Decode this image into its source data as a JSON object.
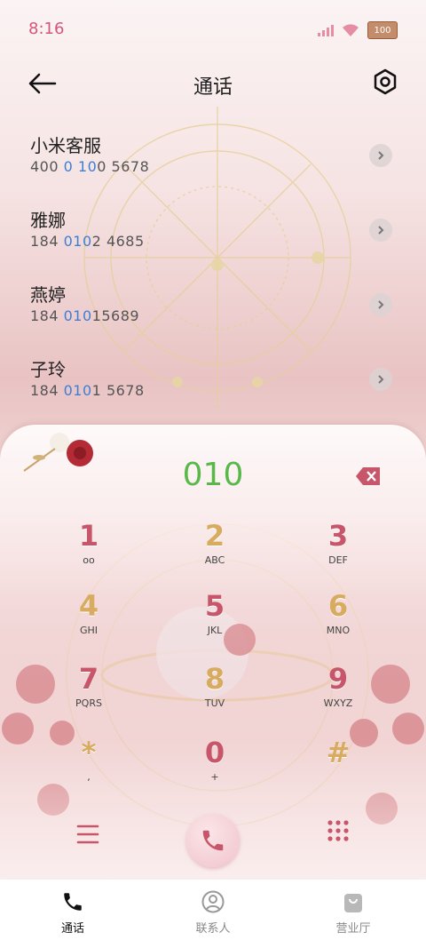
{
  "status": {
    "time": "8:16",
    "battery": "100"
  },
  "header": {
    "title": "通话"
  },
  "contacts": [
    {
      "name": "小米客服",
      "num_a": "400 ",
      "num_hl1": "0",
      "num_b": " ",
      "num_hl2": "10",
      "num_c": "0 5678"
    },
    {
      "name": "雅娜",
      "num_a": "184 ",
      "num_hl1": "010",
      "num_b": "",
      "num_hl2": "",
      "num_c": "2 4685"
    },
    {
      "name": "燕婷",
      "num_a": "184 ",
      "num_hl1": "010",
      "num_b": "",
      "num_hl2": "",
      "num_c": "15689"
    },
    {
      "name": "子玲",
      "num_a": "184 ",
      "num_hl1": "010",
      "num_b": "",
      "num_hl2": "",
      "num_c": "1 5678"
    }
  ],
  "dialer": {
    "input": "010",
    "keys": [
      {
        "digit": "1",
        "sub": "oo"
      },
      {
        "digit": "2",
        "sub": "ABC"
      },
      {
        "digit": "3",
        "sub": "DEF"
      },
      {
        "digit": "4",
        "sub": "GHI"
      },
      {
        "digit": "5",
        "sub": "JKL"
      },
      {
        "digit": "6",
        "sub": "MNO"
      },
      {
        "digit": "7",
        "sub": "PQRS"
      },
      {
        "digit": "8",
        "sub": "TUV"
      },
      {
        "digit": "9",
        "sub": "WXYZ"
      },
      {
        "digit": "*",
        "sub": ","
      },
      {
        "digit": "0",
        "sub": "+"
      },
      {
        "digit": "#",
        "sub": ""
      }
    ]
  },
  "bottom_nav": [
    {
      "label": "通话",
      "icon": "phone-icon"
    },
    {
      "label": "联系人",
      "icon": "person-icon"
    },
    {
      "label": "营业厅",
      "icon": "bag-icon"
    }
  ],
  "colors": {
    "accent_red": "#c7566a",
    "accent_gold": "#d8ac60",
    "input_green": "#5ab84b",
    "highlight_blue": "#3d7fd6"
  }
}
